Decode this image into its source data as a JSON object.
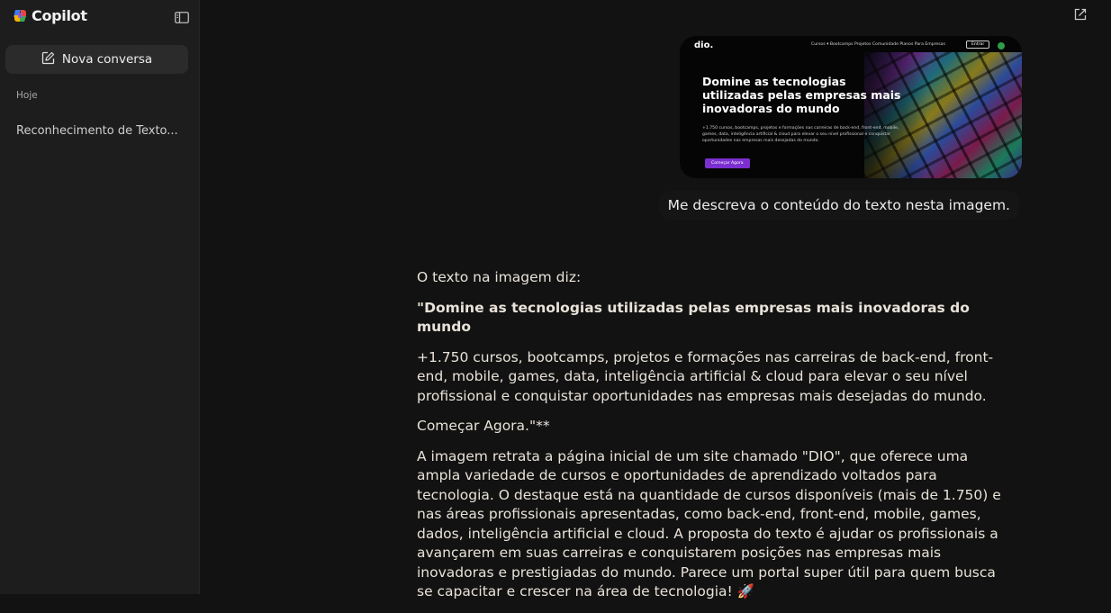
{
  "sidebar": {
    "brand": "Copilot",
    "new_chat_label": "Nova conversa",
    "section_label": "Hoje",
    "history": [
      {
        "title": "Reconhecimento de Texto..."
      }
    ]
  },
  "chat": {
    "attached_image": {
      "logo": "dio.",
      "nav_links": "Cursos ▾   Bootcamps   Projetos   Comunidade   Planos   Para Empresas",
      "enter_button": "Entrar",
      "headline": "Domine as tecnologias utilizadas pelas empresas mais inovadoras do mundo",
      "subtext": "+1.750 cursos, bootcamps, projetos e formações nas carreiras de back-end, front-end, mobile, games, data, inteligência artificial & cloud para elevar o seu nível profissional e conquistar oportunidades nas empresas mais desejadas do mundo.",
      "cta": "Começar Agora"
    },
    "user_message": "Me descreva o conteúdo do texto nesta imagem.",
    "assistant": {
      "intro": "O texto na imagem diz:",
      "quote_title": "\"Domine as tecnologias utilizadas pelas empresas mais inovadoras do mundo",
      "quote_body": "+1.750 cursos, bootcamps, projetos e formações nas carreiras de back-end, front-end, mobile, games, data, inteligência artificial & cloud para elevar o seu nível profissional e conquistar oportunidades nas empresas mais desejadas do mundo.",
      "quote_cta": "Começar Agora.\"**",
      "analysis": "A imagem retrata a página inicial de um site chamado \"DIO\", que oferece uma ampla variedade de cursos e oportunidades de aprendizado voltados para tecnologia. O destaque está na quantidade de cursos disponíveis (mais de 1.750) e nas áreas profissionais apresentadas, como back-end, front-end, mobile, games, dados, inteligência artificial e cloud. A proposta do texto é ajudar os profissionais a avançarem em suas carreiras e conquistarem posições nas empresas mais inovadoras e prestigiadas do mundo. Parece um portal super útil para quem busca se capacitar e crescer na área de tecnologia! 🚀"
    }
  },
  "colors": {
    "background": "#121212",
    "sidebar": "#1d1d1d",
    "accent_cta": "#7b2fd0"
  },
  "icons": [
    "copilot-logo-icon",
    "sidebar-toggle-icon",
    "compose-icon",
    "share-icon"
  ]
}
